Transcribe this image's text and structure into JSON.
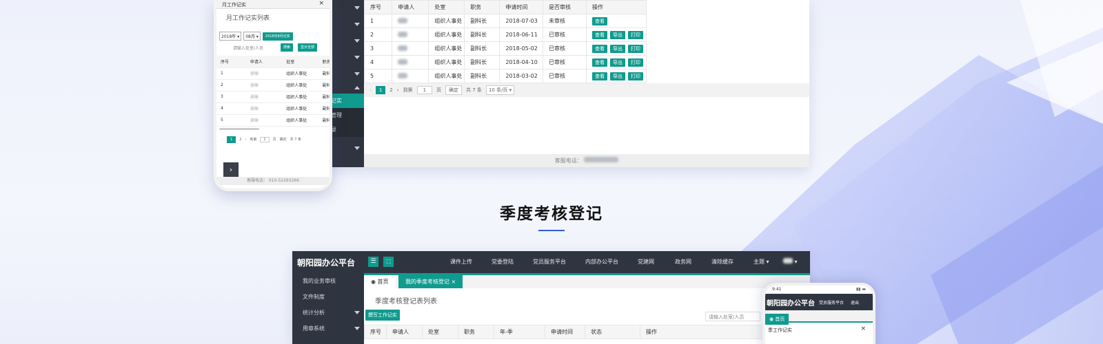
{
  "top_desktop": {
    "sidebar": {
      "submenu": [
        "记实",
        "管理",
        "录"
      ]
    },
    "table": {
      "headers": [
        "序号",
        "申请人",
        "处室",
        "职务",
        "申请时间",
        "是否审核",
        "操作"
      ],
      "rows": [
        {
          "no": "1",
          "dept": "组织人事处",
          "title": "副科长",
          "date": "2018-07-03",
          "status": "未审核",
          "actions": [
            "查看"
          ]
        },
        {
          "no": "2",
          "dept": "组织人事处",
          "title": "副科长",
          "date": "2018-06-11",
          "status": "已审核",
          "actions": [
            "查看",
            "导出",
            "打印"
          ]
        },
        {
          "no": "3",
          "dept": "组织人事处",
          "title": "副科长",
          "date": "2018-05-02",
          "status": "已审核",
          "actions": [
            "查看",
            "导出",
            "打印"
          ]
        },
        {
          "no": "4",
          "dept": "组织人事处",
          "title": "副科长",
          "date": "2018-04-10",
          "status": "已审核",
          "actions": [
            "查看",
            "导出",
            "打印"
          ]
        },
        {
          "no": "5",
          "dept": "组织人事处",
          "title": "副科长",
          "date": "2018-03-02",
          "status": "已审核",
          "actions": [
            "查看",
            "导出",
            "打印"
          ]
        }
      ]
    },
    "pager": {
      "page1": "1",
      "page2": "2",
      "goto": "到第",
      "page_input": "1",
      "page_unit": "页",
      "confirm": "确定",
      "total": "共 7 条",
      "per_page": "10 条/页"
    },
    "footer": "客服电话："
  },
  "top_phone": {
    "header": "月工作记实",
    "close": "×",
    "list_title": "月工作记实列表",
    "year": "2018年",
    "month": "08月",
    "month_tag": "2018年8月记实",
    "search_placeholder": "请输入处室/人员",
    "search_btn": "搜索",
    "show_all_btn": "显示全部",
    "headers": [
      "序号",
      "申请人",
      "处室",
      "职务"
    ],
    "rows": [
      {
        "no": "1",
        "name": "谢琳",
        "dept": "组织人事处",
        "title": "副科长"
      },
      {
        "no": "2",
        "name": "谢琳",
        "dept": "组织人事处",
        "title": "副科长"
      },
      {
        "no": "3",
        "name": "谢琳",
        "dept": "组织人事处",
        "title": "副科长"
      },
      {
        "no": "4",
        "name": "谢琳",
        "dept": "组织人事处",
        "title": "副科长"
      },
      {
        "no": "5",
        "name": "谢琳",
        "dept": "组织人事处",
        "title": "副科长"
      }
    ],
    "pager": {
      "page1": "1",
      "page2": "2",
      "goto": "到第",
      "page_input": "1",
      "page_unit": "页",
      "confirm": "确定",
      "total": "共 7 条"
    },
    "footer": "客服电话：  010-52293266"
  },
  "heading": "季度考核登记",
  "bottom_desktop": {
    "app_title": "朝阳园办公平台",
    "nav": [
      "课件上传",
      "党委登陆",
      "党员服务平台",
      "内部办公平台",
      "党建网",
      "政务网",
      "清除缓存",
      "主题"
    ],
    "sidebar": [
      "我的业务审核",
      "文件制度",
      "统计分析",
      "用章系统"
    ],
    "tab_home": "首页",
    "tab_active": "我的季度考核登记",
    "tab_close": "×",
    "list_title": "季度考核登记表列表",
    "write_btn": "撰写工作记实",
    "search_placeholder": "请输入处室/人员",
    "headers": [
      "序号",
      "申请人",
      "处室",
      "职务",
      "年-季",
      "申请时间",
      "状态",
      "操作"
    ]
  },
  "bottom_phone": {
    "time": "9:41",
    "app_title": "朝阳园办公平台",
    "nav1": "党员服务平台",
    "nav2": "退出",
    "tab_home": "首页",
    "section": "季工作记实",
    "close": "×"
  },
  "colors": {
    "accent": "#0f9b8e",
    "dark": "#2f3540",
    "heading_line": "#2a5fd8"
  }
}
